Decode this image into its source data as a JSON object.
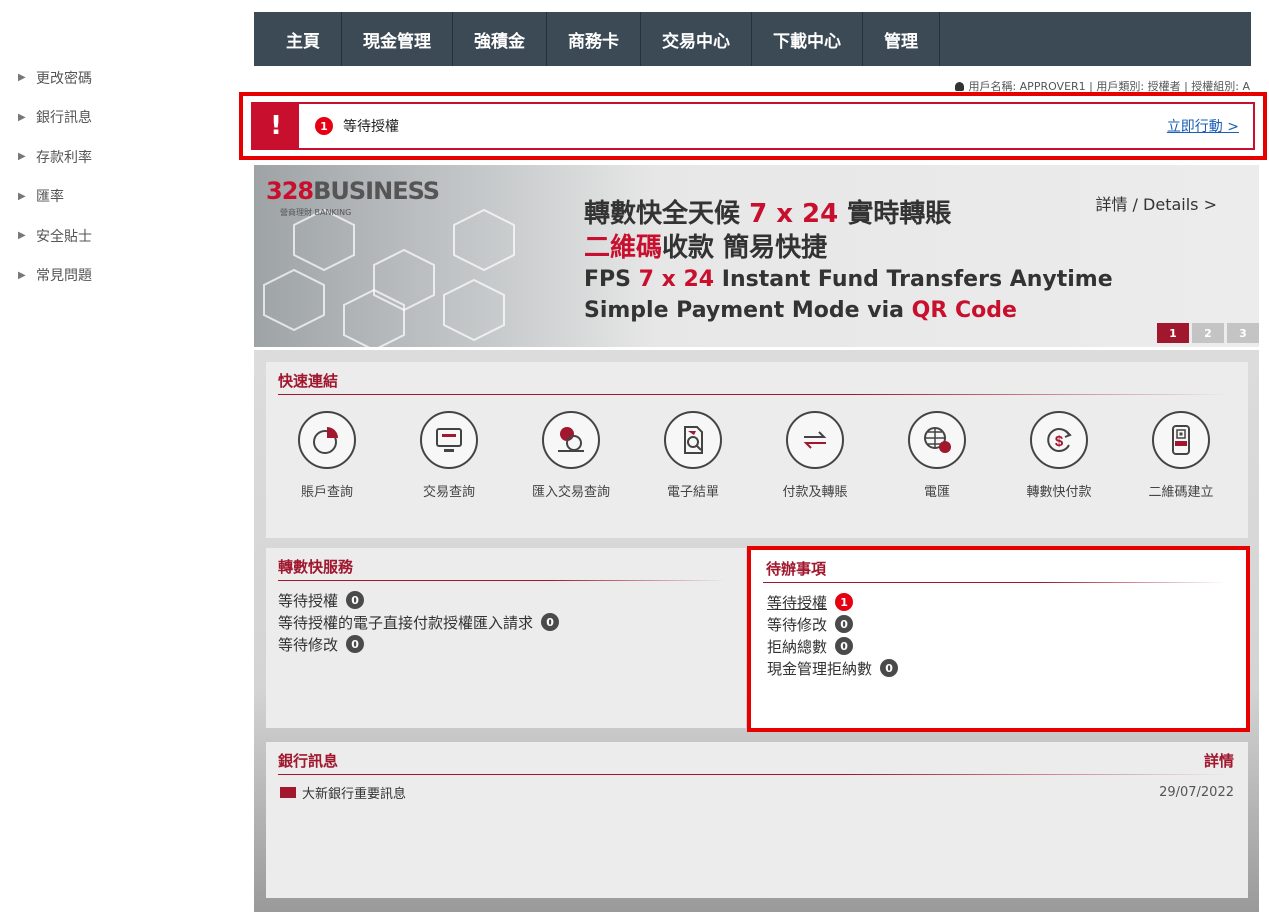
{
  "sidebar": {
    "items": [
      {
        "label": "更改密碼"
      },
      {
        "label": "銀行訊息"
      },
      {
        "label": "存款利率"
      },
      {
        "label": "匯率"
      },
      {
        "label": "安全貼士"
      },
      {
        "label": "常見問題"
      }
    ]
  },
  "nav": {
    "items": [
      {
        "label": "主頁"
      },
      {
        "label": "現金管理"
      },
      {
        "label": "強積金"
      },
      {
        "label": "商務卡"
      },
      {
        "label": "交易中心"
      },
      {
        "label": "下載中心"
      },
      {
        "label": "管理"
      }
    ]
  },
  "user_info": "用戶名稱: APPROVER1 | 用戶類別: 授權者 | 授權組別: A",
  "alert": {
    "icon": "!",
    "count": "1",
    "text": "等待授權",
    "action": "立即行動 >"
  },
  "banner": {
    "logo_number": "328",
    "logo_word": "BUSINESS",
    "logo_sub": "營商理財 BANKING",
    "headline_1a": "轉數快全天候 ",
    "headline_1b": "7 x 24",
    "headline_1c": " 實時轉賬",
    "headline_2a": "二維碼",
    "headline_2b": "收款  簡易快捷",
    "english_1a": "FPS ",
    "english_1b": "7 x 24",
    "english_1c": " Instant Fund Transfers Anytime",
    "english_2a": "Simple Payment Mode via ",
    "english_2b": "QR Code",
    "details": "詳情 / Details >",
    "pages": [
      "1",
      "2",
      "3"
    ],
    "active_page": "1",
    "accent_color": "#c8102e"
  },
  "quick_links": {
    "title": "快速連結",
    "items": [
      {
        "label": "賬戶查詢",
        "icon": "pie-chart-icon"
      },
      {
        "label": "交易查詢",
        "icon": "monitor-icon"
      },
      {
        "label": "匯入交易查詢",
        "icon": "coins-hand-icon"
      },
      {
        "label": "電子結單",
        "icon": "document-search-icon"
      },
      {
        "label": "付款及轉賬",
        "icon": "transfer-arrows-icon"
      },
      {
        "label": "電匯",
        "icon": "globe-dollar-icon"
      },
      {
        "label": "轉數快付款",
        "icon": "dollar-cycle-icon"
      },
      {
        "label": "二維碼建立",
        "icon": "fps-qr-phone-icon"
      }
    ]
  },
  "fps_services": {
    "title": "轉數快服務",
    "rows": [
      {
        "label": "等待授權",
        "count": "0"
      },
      {
        "label": "等待授權的電子直接付款授權匯入請求",
        "count": "0"
      },
      {
        "label": "等待修改",
        "count": "0"
      }
    ]
  },
  "todo": {
    "title": "待辦事項",
    "rows": [
      {
        "label": "等待授權",
        "count": "1"
      },
      {
        "label": "等待修改",
        "count": "0"
      },
      {
        "label": "拒納總數",
        "count": "0"
      },
      {
        "label": "現金管理拒納數",
        "count": "0"
      }
    ]
  },
  "bank_news": {
    "title": "銀行訊息",
    "more": "詳情",
    "items": [
      {
        "title": "大新銀行重要訊息",
        "date": "29/07/2022"
      }
    ]
  },
  "colors": {
    "brand_red": "#a0172e",
    "alert_red": "#e60000",
    "nav_bg": "#3c4a55",
    "link_blue": "#1a5fb4"
  }
}
